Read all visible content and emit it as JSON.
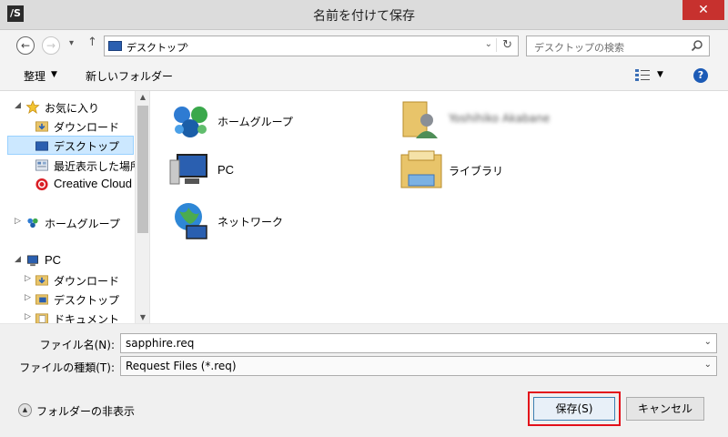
{
  "window": {
    "title": "名前を付けて保存",
    "app_icon_text": "/S",
    "close_glyph": "✕"
  },
  "address": {
    "back_glyph": "←",
    "forward_glyph": "→",
    "recent_glyph": "▾",
    "up_glyph": "↑",
    "path_label": "デスクトップ",
    "path_chevron": "›",
    "dropdown_glyph": "⌄",
    "refresh_glyph": "↻"
  },
  "search": {
    "placeholder": "デスクトップの検索"
  },
  "toolbar": {
    "organize_label": "整理",
    "organize_dd": "▼",
    "new_folder_label": "新しいフォルダー",
    "view_dd": "▼",
    "help_glyph": "?"
  },
  "nav": {
    "items": [
      {
        "label": "お気に入り",
        "icon": "star-icon"
      },
      {
        "label": "ダウンロード",
        "icon": "download-folder-icon"
      },
      {
        "label": "デスクトップ",
        "icon": "desktop-icon"
      },
      {
        "label": "最近表示した場所",
        "icon": "recent-places-icon"
      },
      {
        "label": "Creative Cloud",
        "icon": "creative-cloud-icon"
      },
      {
        "label": "ホームグループ",
        "icon": "homegroup-icon"
      },
      {
        "label": "PC",
        "icon": "pc-icon"
      },
      {
        "label": "ダウンロード",
        "icon": "download-folder-icon"
      },
      {
        "label": "デスクトップ",
        "icon": "desktop-folder-icon"
      },
      {
        "label": "ドキュメント",
        "icon": "documents-folder-icon"
      }
    ],
    "expanded_glyph": "◢",
    "collapsed_glyph": "▷",
    "scroll_up": "▲",
    "scroll_down": "▼"
  },
  "content": {
    "items": [
      {
        "label": "ホームグループ",
        "icon": "homegroup-icon"
      },
      {
        "label": "Yoshihiko Akabane",
        "icon": "user-folder-icon"
      },
      {
        "label": "PC",
        "icon": "pc-icon"
      },
      {
        "label": "ライブラリ",
        "icon": "libraries-icon"
      },
      {
        "label": "ネットワーク",
        "icon": "network-icon"
      }
    ]
  },
  "form": {
    "filename_label": "ファイル名(N):",
    "filename_value": "sapphire.req",
    "filetype_label": "ファイルの種類(T):",
    "filetype_value": "Request Files (*.req)",
    "dd_glyph": "⌄"
  },
  "footer": {
    "hide_folders_label": "フォルダーの非表示",
    "hide_folders_glyph": "▲",
    "save_label": "保存(S)",
    "cancel_label": "キャンセル"
  },
  "colors": {
    "accent": "#1c5bb6",
    "selection": "#cce8ff",
    "close": "#c7312e",
    "highlight": "#e3101a"
  }
}
